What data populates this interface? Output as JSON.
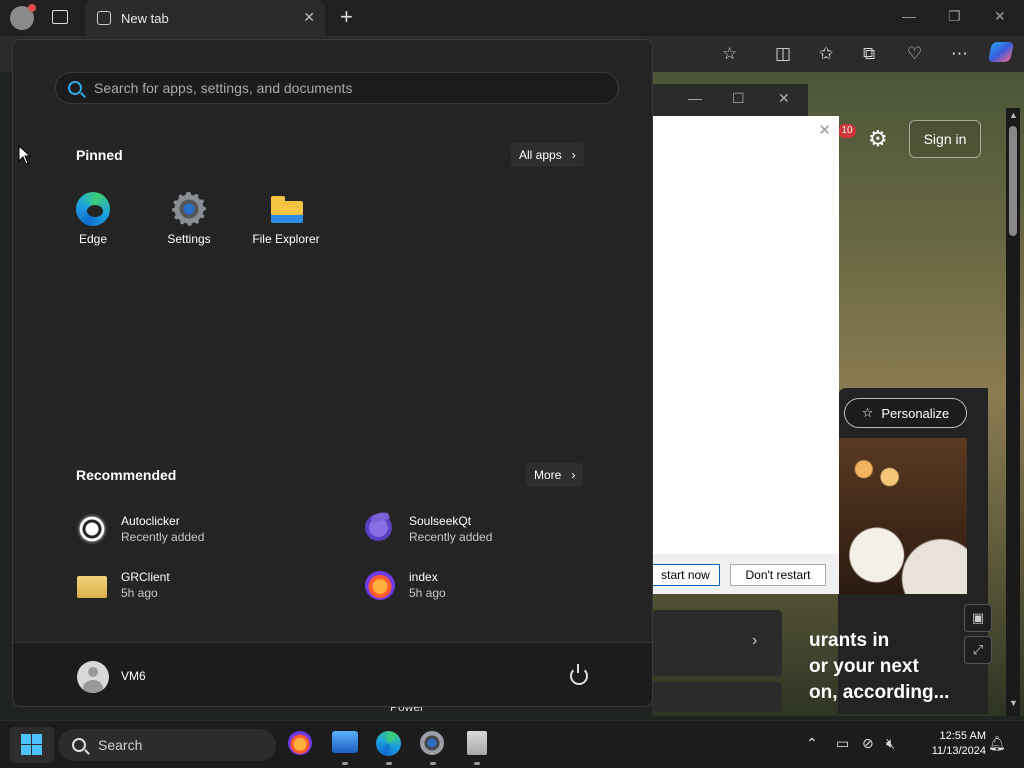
{
  "browser": {
    "tab_title": "New tab",
    "tab_close": "✕",
    "new_tab": "+",
    "window_controls": [
      "—",
      "❐",
      "✕"
    ],
    "toolbar_icons": [
      "star-icon",
      "split-screen-icon",
      "favorites-icon",
      "collections-icon",
      "heartbeat-icon",
      "more-icon",
      "copilot-icon"
    ]
  },
  "background_page": {
    "notification_count": "10",
    "sign_in": "Sign in",
    "personalize": "Personalize",
    "headline": "urants in\nor your next\non, according..."
  },
  "restart_dialog": {
    "restart_now": "start now",
    "dont_restart": "Don't restart"
  },
  "start_menu": {
    "search_placeholder": "Search for apps, settings, and documents",
    "pinned_title": "Pinned",
    "all_apps": "All apps",
    "pinned": [
      {
        "label": "Edge",
        "icon": "edge-icon"
      },
      {
        "label": "Settings",
        "icon": "settings-gear-icon"
      },
      {
        "label": "File Explorer",
        "icon": "folder-icon"
      }
    ],
    "recommended_title": "Recommended",
    "more": "More",
    "recommended": [
      {
        "name": "Autoclicker",
        "sub": "Recently added",
        "icon": "autoclicker-icon"
      },
      {
        "name": "SoulseekQt",
        "sub": "Recently added",
        "icon": "soulseek-icon"
      },
      {
        "name": "GRClient",
        "sub": "5h ago",
        "icon": "zip-folder-icon"
      },
      {
        "name": "index",
        "sub": "5h ago",
        "icon": "firefox-file-icon"
      }
    ],
    "user_name": "VM6"
  },
  "taskbar": {
    "search_label": "Search",
    "apps": [
      "firefox-icon",
      "photos-icon",
      "edge-icon",
      "settings-icon",
      "notepad-icon"
    ],
    "time": "12:55 AM",
    "date": "11/13/2024",
    "accent": "#4cc2ff"
  },
  "peek_text": "Power"
}
